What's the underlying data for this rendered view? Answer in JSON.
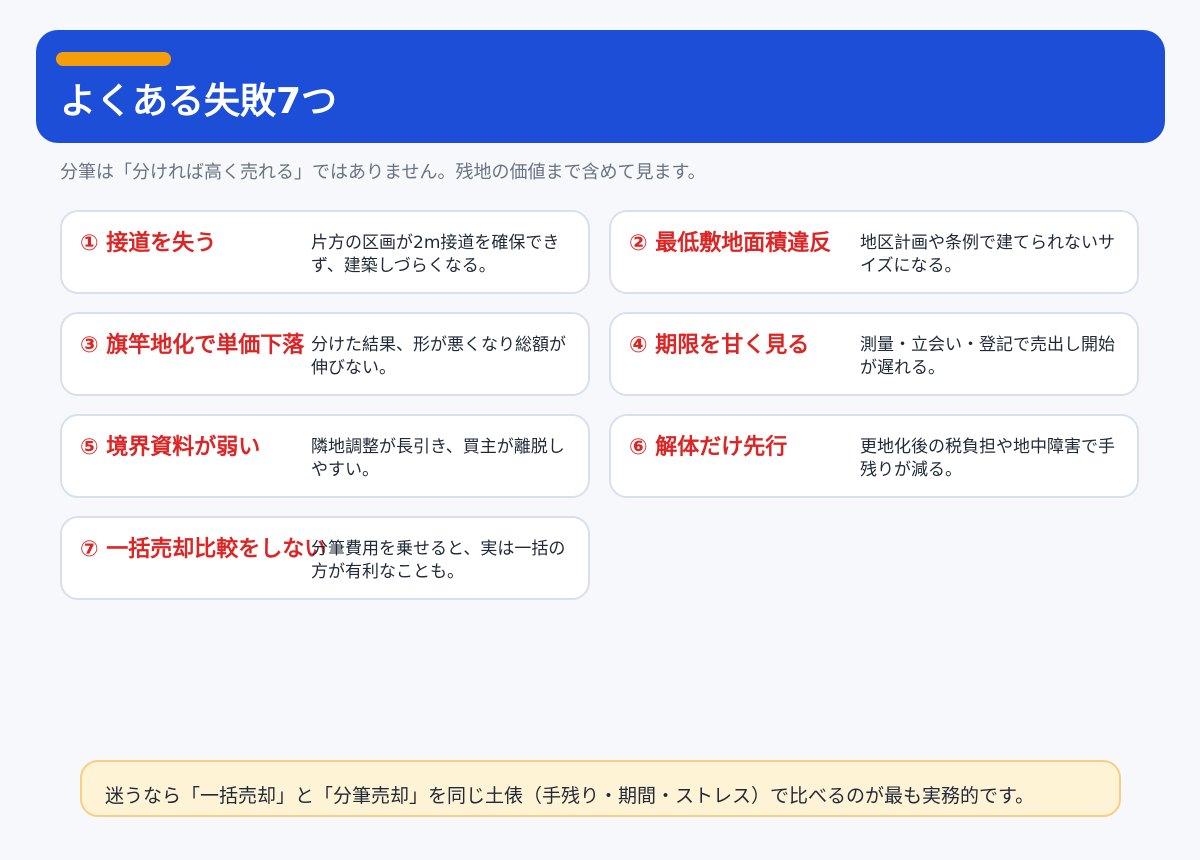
{
  "header": {
    "title": "よくある失敗7つ",
    "accent_color": "#f59e0b",
    "background_color": "#1d4ed8"
  },
  "subtitle": "分筆は「分ければ高く売れる」ではありません。残地の価値まで含めて見ます。",
  "items": [
    {
      "head": "① 接道を失う",
      "desc": "片方の区画が2m接道を確保できず、建築しづらくなる。"
    },
    {
      "head": "② 最低敷地面積違反",
      "desc": "地区計画や条例で建てられないサイズになる。"
    },
    {
      "head": "③ 旗竿地化で単価下落",
      "desc": "分けた結果、形が悪くなり総額が伸びない。"
    },
    {
      "head": "④ 期限を甘く見る",
      "desc": "測量・立会い・登記で売出し開始が遅れる。"
    },
    {
      "head": "⑤ 境界資料が弱い",
      "desc": "隣地調整が長引き、買主が離脱しやすい。"
    },
    {
      "head": "⑥ 解体だけ先行",
      "desc": "更地化後の税負担や地中障害で手残りが減る。"
    },
    {
      "head": "⑦ 一括売却比較をしない",
      "desc": "分筆費用を乗せると、実は一括の方が有利なことも。"
    }
  ],
  "note": "迷うなら「一括売却」と「分筆売却」を同じ土俵（手残り・期間・ストレス）で比べるのが最も実務的です。"
}
